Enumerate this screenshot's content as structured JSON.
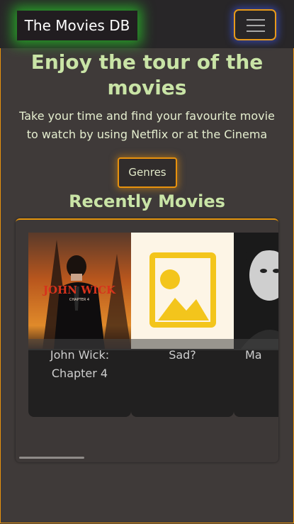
{
  "navbar": {
    "brand": "The Movies DB",
    "toggle_icon": "hamburger-menu-icon",
    "brand_glow_color": "#2fcf2f",
    "toggle_border_color": "#e89a1a"
  },
  "hero": {
    "title": "Enjoy the tour of the movies",
    "subtitle": "Take your time and find your favourite movie to watch by using Netflix or at the Cinema"
  },
  "genres_button": {
    "label": "Genres"
  },
  "recent": {
    "title": "Recently Movies",
    "movies": [
      {
        "title": "John Wick: Chapter 4",
        "poster_text": "JOHN WICK",
        "poster_subtext": "CHAPTER 4"
      },
      {
        "title": "Sad?",
        "poster_icon": "image-placeholder-icon"
      },
      {
        "title": "Ma"
      }
    ]
  },
  "colors": {
    "accent": "#e8930d",
    "heading": "#c9e4a6",
    "background": "#3f3a39",
    "navbar": "#282628"
  }
}
